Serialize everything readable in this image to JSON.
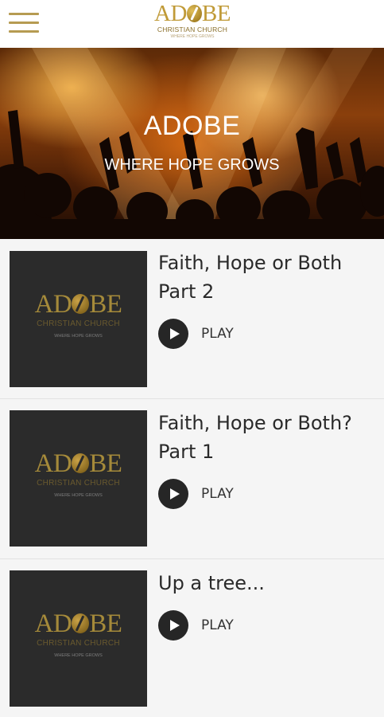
{
  "header": {
    "logo_text_left": "AD",
    "logo_text_right": "BE",
    "logo_subtitle": "CHRISTIAN CHURCH",
    "logo_tagline": "WHERE HOPE GROWS"
  },
  "hero": {
    "title": "ADOBE",
    "subtitle": "WHERE HOPE GROWS"
  },
  "thumbnail": {
    "word_left": "AD",
    "word_right": "BE",
    "subtitle": "CHRISTIAN CHURCH",
    "tagline": "WHERE HOPE GROWS"
  },
  "episodes": [
    {
      "title": "Faith, Hope or Both Part 2",
      "play_label": "PLAY"
    },
    {
      "title": "Faith, Hope or Both? Part 1",
      "play_label": "PLAY"
    },
    {
      "title": "Up a tree...",
      "play_label": "PLAY"
    }
  ],
  "colors": {
    "gold": "#c09a37",
    "thumb_bg": "#2b2b2b",
    "play_button": "#262626"
  }
}
